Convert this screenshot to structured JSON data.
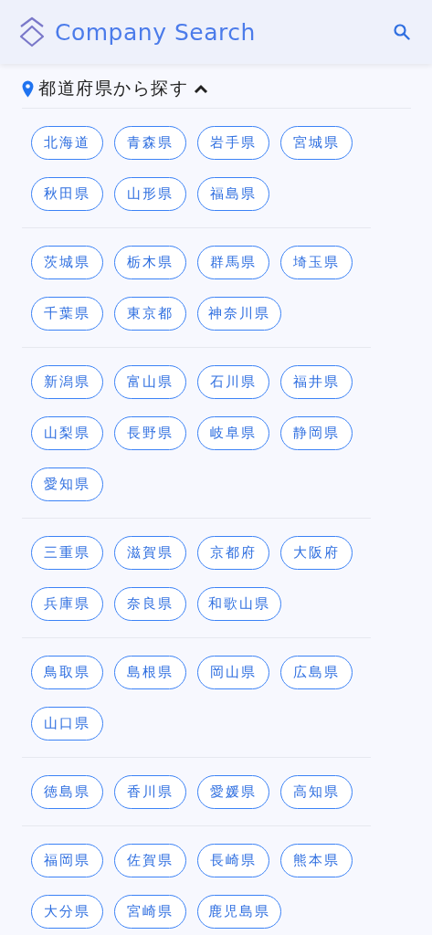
{
  "header": {
    "title": "Company Search"
  },
  "section": {
    "title": "都道府県から探す",
    "expanded": true,
    "groups": [
      [
        "北海道",
        "青森県",
        "岩手県",
        "宮城県",
        "秋田県",
        "山形県",
        "福島県"
      ],
      [
        "茨城県",
        "栃木県",
        "群馬県",
        "埼玉県",
        "千葉県",
        "東京都",
        "神奈川県"
      ],
      [
        "新潟県",
        "富山県",
        "石川県",
        "福井県",
        "山梨県",
        "長野県",
        "岐阜県",
        "静岡県",
        "愛知県"
      ],
      [
        "三重県",
        "滋賀県",
        "京都府",
        "大阪府",
        "兵庫県",
        "奈良県",
        "和歌山県"
      ],
      [
        "鳥取県",
        "島根県",
        "岡山県",
        "広島県",
        "山口県"
      ],
      [
        "徳島県",
        "香川県",
        "愛媛県",
        "高知県"
      ],
      [
        "福岡県",
        "佐賀県",
        "長崎県",
        "熊本県",
        "大分県",
        "宮崎県",
        "鹿児島県"
      ]
    ]
  }
}
